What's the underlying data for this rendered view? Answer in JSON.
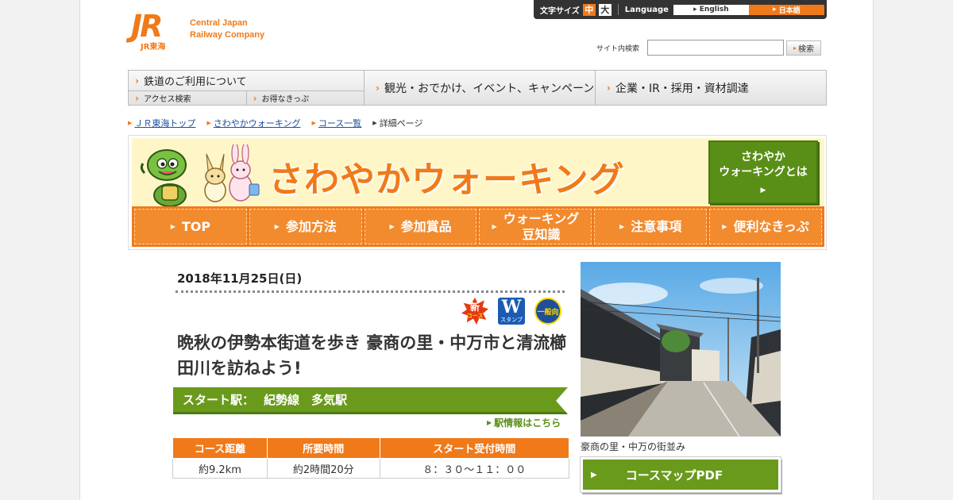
{
  "brand": {
    "logo_mark": "JR",
    "logo_sub": "JR東海",
    "name_line1": "Central Japan",
    "name_line2": "Railway Company",
    "accent_color": "#f07a1a"
  },
  "utility": {
    "font_size_label": "文字サイズ",
    "font_mid": "中",
    "font_large": "大",
    "language_label": "Language",
    "english": "English",
    "japanese": "日本語"
  },
  "search": {
    "label": "サイト内検索",
    "placeholder": "",
    "button": "検索"
  },
  "global_nav": {
    "rail_use": "鉄道のご利用について",
    "access_search": "アクセス検索",
    "tickets": "お得なきっぷ",
    "tourism": "観光・おでかけ、イベント、キャンペーン",
    "corporate": "企業・IR・採用・資材調達"
  },
  "breadcrumb": [
    "ＪＲ東海トップ",
    "さわやかウォーキング",
    "コース一覧",
    "詳細ページ"
  ],
  "banner": {
    "title": "さわやかウォーキング",
    "about_line1": "さわやか",
    "about_line2": "ウォーキングとは",
    "nav": [
      {
        "label": "TOP"
      },
      {
        "label": "参加方法"
      },
      {
        "label": "参加賞品"
      },
      {
        "label_line1": "ウォーキング",
        "label_line2": "豆知識"
      },
      {
        "label": "注意事項"
      },
      {
        "label": "便利なきっぷ"
      }
    ]
  },
  "detail": {
    "date": "2018年11月25日(日)",
    "badges": {
      "new_main": "新",
      "new_sub": "コース",
      "w_main": "W",
      "w_sub": "スタンプ",
      "general": "一般向"
    },
    "title": "晩秋の伊勢本街道を歩き 豪商の里・中万市と清流櫛田川を訪ねよう!",
    "start_label": "スタート駅：",
    "start_station": "紀勢線　多気駅",
    "station_link": "駅情報はこちら",
    "table": {
      "headers": [
        "コース距離",
        "所要時間",
        "スタート受付時間"
      ],
      "values": [
        "約9.2km",
        "約2時間20分",
        "８：３０～１１：００"
      ]
    },
    "photo_caption": "豪商の里・中万の街並み",
    "pdf_button": "コースマップPDF"
  }
}
